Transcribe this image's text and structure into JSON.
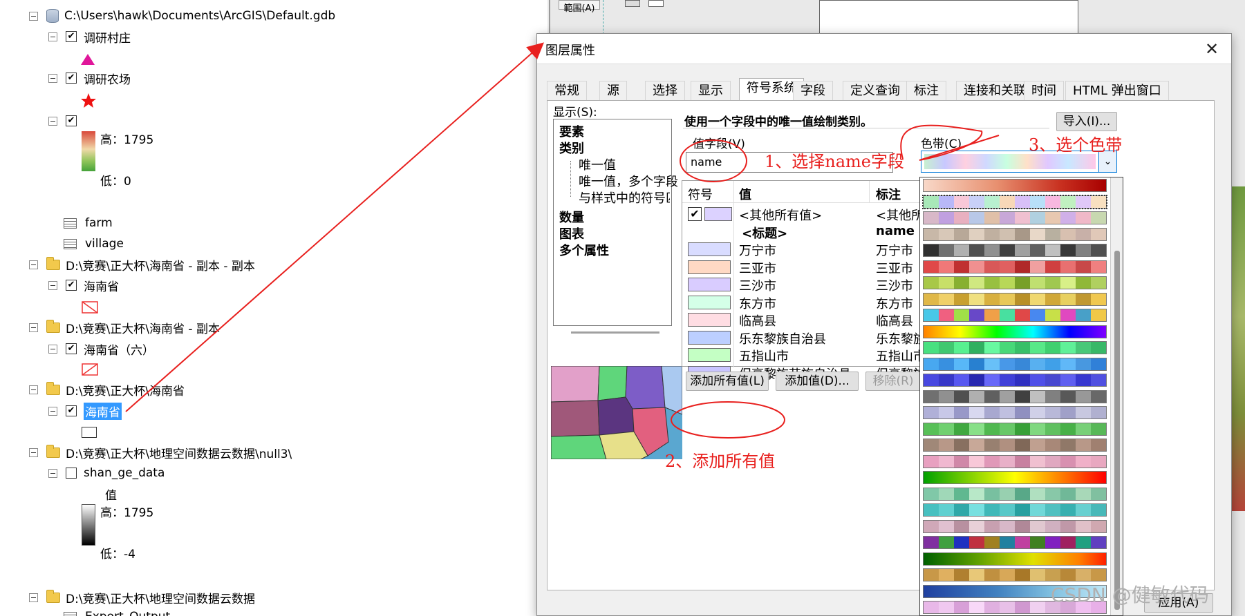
{
  "toc": {
    "gdb_path": "C:\\Users\\hawk\\Documents\\ArcGIS\\Default.gdb",
    "layer_villages": "调研村庄",
    "layer_farms": "调研农场",
    "raster_high": "高：1795",
    "raster_low": "低：0",
    "table_farm": "farm",
    "table_village": "village",
    "group1_path": "D:\\竞赛\\正大杯\\海南省 - 副本 - 副本",
    "group1_layer": "海南省",
    "group2_path": "D:\\竞赛\\正大杯\\海南省 - 副本",
    "group2_layer": "海南省（六）",
    "group3_path": "D:\\竞赛\\正大杯\\海南省",
    "group3_layer": "海南省",
    "group4_path": "D:\\竞赛\\正大杯\\地理空间数据云数据\\null3\\",
    "group4_layer": "shan_ge_data",
    "value_label": "值",
    "group4_high": "高：1795",
    "group4_low": "低：-4",
    "group5_path": "D:\\竞赛\\正大杯\\地理空间数据云数据",
    "group5_layer": "Export_Output"
  },
  "background": {
    "menu_text": "範围(A)"
  },
  "dialog": {
    "title": "图层属性",
    "close": "✕",
    "tabs": [
      "常规",
      "源",
      "选择",
      "显示",
      "符号系统",
      "字段",
      "定义查询",
      "标注",
      "连接和关联",
      "时间",
      "HTML 弹出窗口"
    ],
    "active_tab": "符号系统",
    "show_label": "显示(S):",
    "show_items": [
      "要素",
      "类别",
      "唯一值",
      "唯一值，多个字段",
      "与样式中的符号匹配",
      "数量",
      "图表",
      "多个属性"
    ],
    "description": "使用一个字段中的唯一值绘制类别。",
    "import_button": "导入(I)...",
    "value_field_label": "值字段(V)",
    "value_field_value": "name",
    "color_ramp_label": "色带(C)",
    "grid_headers": [
      "符号",
      "值",
      "标注"
    ],
    "rows": [
      {
        "value": "<其他所有值>",
        "label": "<其他所有值>",
        "color": "#dcd2ff",
        "checked": true
      },
      {
        "value": "<标题>",
        "label": "name",
        "heading": true
      },
      {
        "value": "万宁市",
        "label": "万宁市",
        "color": "#d9dcff"
      },
      {
        "value": "三亚市",
        "label": "三亚市",
        "color": "#ffd9c4"
      },
      {
        "value": "三沙市",
        "label": "三沙市",
        "color": "#d9ccff"
      },
      {
        "value": "东方市",
        "label": "东方市",
        "color": "#d4ffe8"
      },
      {
        "value": "临高县",
        "label": "临高县",
        "color": "#ffdde3"
      },
      {
        "value": "乐东黎族自治县",
        "label": "乐东黎族自治县",
        "color": "#bccfff"
      },
      {
        "value": "五指山市",
        "label": "五指山市",
        "color": "#c4ffc4"
      },
      {
        "value": "保亭黎族苗族自治县",
        "label": "保亭黎族苗族自治县",
        "color": "#c9c4ff"
      }
    ],
    "add_all_button": "添加所有值(L)",
    "add_value_button": "添加值(D)...",
    "remove_button": "移除(R)",
    "apply_button": "应用(A)"
  },
  "annotations": {
    "step1": "1、选择name字段",
    "step2": "2、添加所有值",
    "step3": "3、选个色带"
  },
  "watermark": "CSDN @健敏代码"
}
